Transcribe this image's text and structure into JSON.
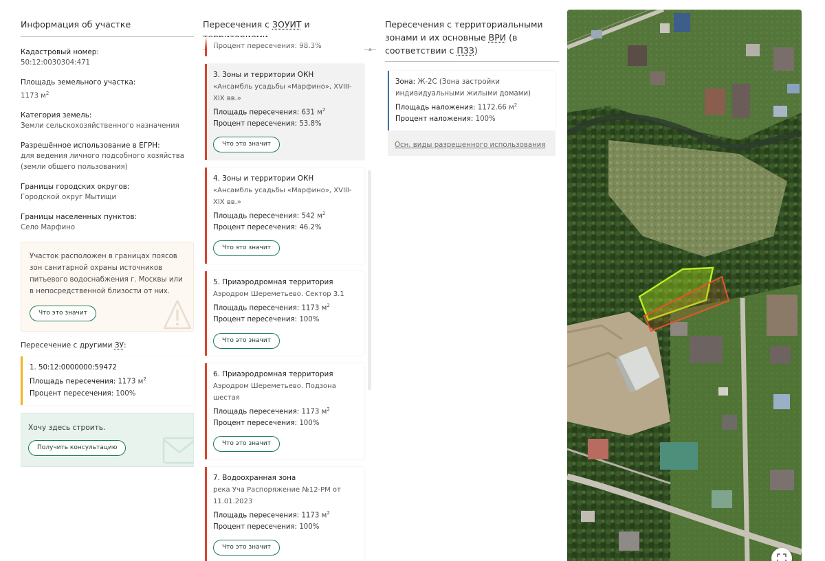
{
  "parcel_info": {
    "header": "Информация об участке",
    "cadastral_label": "Кадастровый номер:",
    "cadastral_value": "50:12:0030304:471",
    "area_label": "Площадь земельного участка:",
    "area_value": "1173 м",
    "area_sup": "2",
    "category_label": "Категория земель:",
    "category_value": "Земли сельскохозяйственного назначения",
    "usage_label": "Разрешённое использование в ЕГРН:",
    "usage_value": "для ведения личного подсобного хозяйства (земли общего пользования)",
    "district_label": "Границы городских округов:",
    "district_value": "Городской округ Мытищи",
    "settlement_label": "Границы населенных пунктов:",
    "settlement_value": "Село Марфино",
    "warning_text": "Участок расположен в границах поясов зон санитарной охраны источников питьевого водоснабжения г. Москвы или в непосредственной близости от них.",
    "warning_button": "Что это значит",
    "other_header_prefix": "Пересечение с другими ",
    "other_header_abbr": "ЗУ",
    "other_header_suffix": ":",
    "other_item": {
      "title": "1. 50:12:0000000:59472",
      "area_label": "Площадь пересечения:",
      "area_value": "1173 м",
      "area_sup": "2",
      "percent_label": "Процент пересечения:",
      "percent_value": "100%"
    },
    "build_text": "Хочу здесь строить.",
    "build_button": "Получить консультацию"
  },
  "zouit": {
    "header_prefix": "Пересечения с ",
    "header_abbr": "ЗОУИТ",
    "header_suffix": " и территориями",
    "partial_text": "Процент пересечения: 98.3%",
    "area_label": "Площадь пересечения:",
    "percent_label": "Процент пересечения:",
    "button_label": "Что это значит",
    "items": [
      {
        "title": "3. Зоны и территории ОКН",
        "sub": "«Ансамбль усадьбы «Марфино», XVIII-XIX вв.»",
        "area": "631 м",
        "sup": "2",
        "percent": "53.8%"
      },
      {
        "title": "4. Зоны и территории ОКН",
        "sub": "«Ансамбль усадьбы «Марфино», XVIII-XIX вв.»",
        "area": "542 м",
        "sup": "2",
        "percent": "46.2%"
      },
      {
        "title": "5. Приаэродромная территория",
        "sub": "Аэродром Шереметьево. Сектор 3.1",
        "area": "1173 м",
        "sup": "2",
        "percent": "100%"
      },
      {
        "title": "6. Приаэродромная территория",
        "sub": "Аэродром Шереметьево. Подзона шестая",
        "area": "1173 м",
        "sup": "2",
        "percent": "100%"
      },
      {
        "title": "7. Водоохранная зона",
        "sub": "река Уча Распоряжение №12-РМ от 11.01.2023",
        "area": "1173 м",
        "sup": "2",
        "percent": "100%"
      }
    ]
  },
  "zones": {
    "header_line1": "Пересечения с территориальными",
    "header_line2_prefix": "зонами и их основные ",
    "header_abbr1": "ВРИ",
    "header_line2_suffix": " (в",
    "header_line3_prefix": "соответствии с ",
    "header_abbr2": "ПЗЗ",
    "header_line3_suffix": ")",
    "zone_label": "Зона:",
    "zone_value": "Ж-2С (Зона застройки индивидуальными жилыми домами)",
    "overlap_area_label": "Площадь наложения:",
    "overlap_area_value": "1172.66 м",
    "overlap_area_sup": "2",
    "overlap_percent_label": "Процент наложения:",
    "overlap_percent_value": "100%",
    "link_text": "Осн. виды разрешенного использования"
  },
  "map": {
    "expand_icon": "expand-icon",
    "parcel_outline_color": "#e8542a",
    "zone_outline_color": "#b8f01e"
  },
  "colors": {
    "accent_green": "#1f7a55",
    "zouit_red": "#d6452f",
    "warning_yellow": "#f2b51e",
    "zone_blue": "#3b6fa8"
  }
}
